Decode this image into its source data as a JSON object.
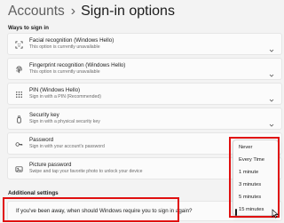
{
  "header": {
    "breadcrumb": "Accounts",
    "separator": "›",
    "title": "Sign-in options"
  },
  "sections": {
    "ways_to_sign_in": "Ways to sign in",
    "additional_settings": "Additional settings"
  },
  "options": [
    {
      "icon": "face-recognition-icon",
      "title": "Facial recognition (Windows Hello)",
      "subtitle": "This option is currently unavailable"
    },
    {
      "icon": "fingerprint-icon",
      "title": "Fingerprint recognition (Windows Hello)",
      "subtitle": "This option is currently unavailable"
    },
    {
      "icon": "pin-grid-icon",
      "title": "PIN (Windows Hello)",
      "subtitle": "Sign in with a PIN (Recommended)"
    },
    {
      "icon": "security-key-icon",
      "title": "Security key",
      "subtitle": "Sign in with a physical security key"
    },
    {
      "icon": "password-key-icon",
      "title": "Password",
      "subtitle": "Sign in with your account's password"
    },
    {
      "icon": "picture-password-icon",
      "title": "Picture password",
      "subtitle": "Swipe and tap your favorite photo to unlock your device"
    }
  ],
  "require_signin": {
    "question": "If you've been away, when should Windows require you to sign in again?"
  },
  "dropdown": {
    "options": [
      "Never",
      "Every Time",
      "1 minute",
      "3 minutes",
      "5 minutes",
      "15 minutes"
    ],
    "selected": "15 minutes"
  },
  "colors": {
    "highlight": "#e01010",
    "background": "#f3f3f3",
    "card": "#fbfbfb"
  }
}
